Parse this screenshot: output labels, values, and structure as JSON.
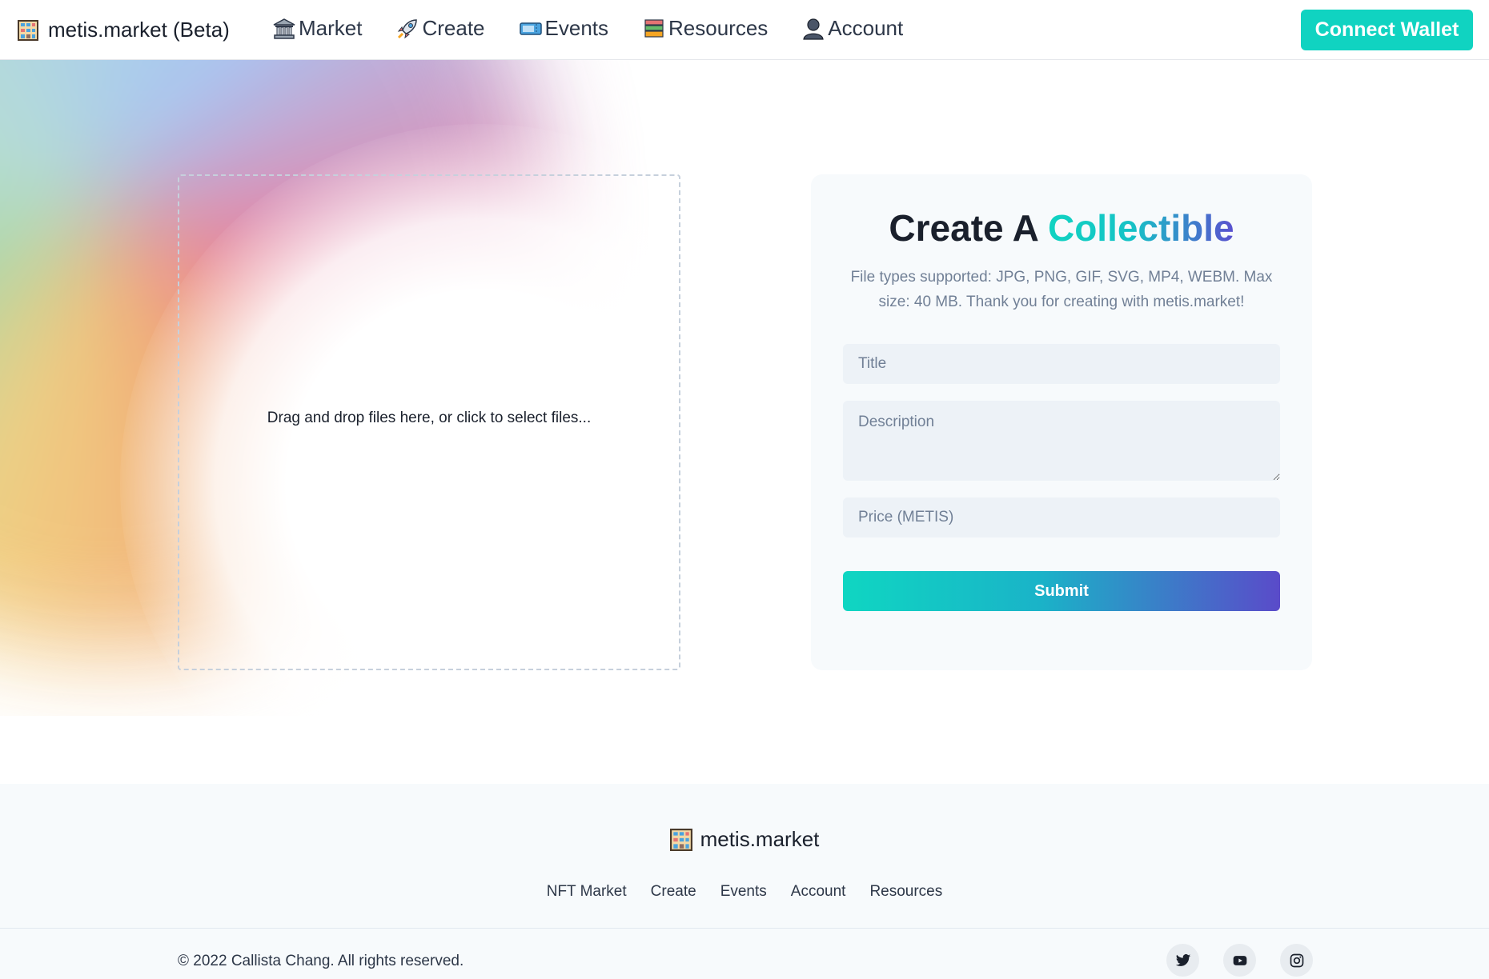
{
  "header": {
    "brand": "metis.market (Beta)",
    "nav": [
      {
        "label": "Market",
        "icon": "bank-icon"
      },
      {
        "label": "Create",
        "icon": "rocket-icon"
      },
      {
        "label": "Events",
        "icon": "ticket-icon"
      },
      {
        "label": "Resources",
        "icon": "books-icon"
      },
      {
        "label": "Account",
        "icon": "person-icon"
      }
    ],
    "connect_wallet": "Connect Wallet"
  },
  "dropzone": {
    "text": "Drag and drop files here, or click to select files..."
  },
  "form": {
    "title_prefix": "Create A ",
    "title_accent": "Collectible",
    "subtitle": "File types supported: JPG, PNG, GIF, SVG, MP4, WEBM. Max size: 40 MB. Thank you for creating with metis.market!",
    "title_placeholder": "Title",
    "description_placeholder": "Description",
    "price_placeholder": "Price (METIS)",
    "submit": "Submit"
  },
  "footer": {
    "brand": "metis.market",
    "links": [
      "NFT Market",
      "Create",
      "Events",
      "Account",
      "Resources"
    ],
    "copyright": "© 2022 Callista Chang. All rights reserved.",
    "socials": [
      "twitter-icon",
      "youtube-icon",
      "instagram-icon"
    ]
  },
  "colors": {
    "accent": "#10d3c1",
    "gradient_end": "#5a4bc9",
    "card_bg": "#f7fafc",
    "field_bg": "#edf2f7"
  }
}
